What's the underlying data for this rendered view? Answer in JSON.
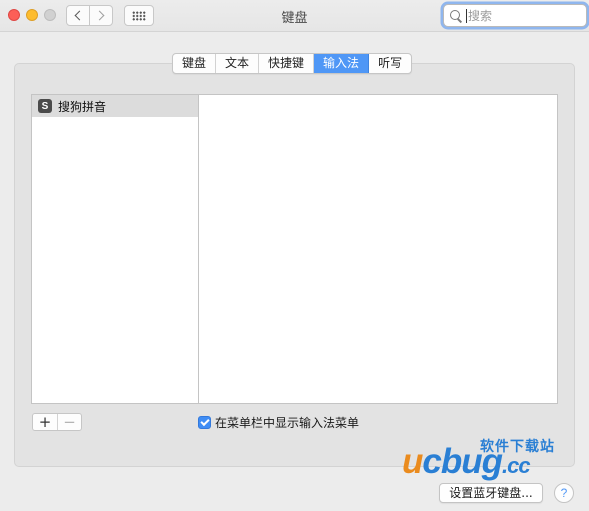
{
  "window": {
    "title": "键盘"
  },
  "search": {
    "placeholder": "搜索"
  },
  "tabs": [
    {
      "label": "键盘",
      "active": false
    },
    {
      "label": "文本",
      "active": false
    },
    {
      "label": "快捷键",
      "active": false
    },
    {
      "label": "输入法",
      "active": true
    },
    {
      "label": "听写",
      "active": false
    }
  ],
  "input_sources": [
    {
      "label": "搜狗拼音",
      "icon": "sogou-s-icon",
      "icon_glyph": "S",
      "selected": true
    }
  ],
  "list_controls": {
    "add": "+",
    "remove": "−"
  },
  "show_in_menu_bar": {
    "label": "在菜单栏中显示输入法菜单",
    "checked": true
  },
  "bluetooth_button": {
    "label": "设置蓝牙键盘..."
  },
  "help_button": {
    "label": "?"
  },
  "watermark": {
    "brand_first": "u",
    "brand_rest": "cbug",
    "suffix": ".cc",
    "tagline": "软件下载站"
  },
  "colors": {
    "accent": "#4f97f6",
    "close": "#fc5f57",
    "minimize": "#fdbc2e",
    "watermark_blue": "#2a7fd4",
    "watermark_orange": "#ea8b1e"
  }
}
